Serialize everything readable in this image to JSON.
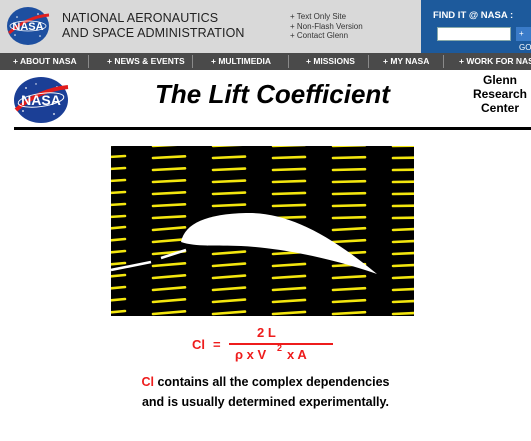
{
  "header": {
    "agency_line1": "NATIONAL AERONAUTICS",
    "agency_line2": "AND SPACE ADMINISTRATION",
    "logo_text": "NASA",
    "utility_links": [
      "+ Text Only Site",
      "+ Non-Flash Version",
      "+ Contact Glenn"
    ],
    "findit_label": "FIND IT @ NASA :",
    "findit_go": "+ GO"
  },
  "nav": {
    "items": [
      "+ ABOUT NASA",
      "+ NEWS & EVENTS",
      "+ MULTIMEDIA",
      "+ MISSIONS",
      "+ MY NASA",
      "+ WORK FOR NASA"
    ]
  },
  "page": {
    "title": "The Lift Coefficient",
    "logo_text": "NASA",
    "center_line1": "Glenn",
    "center_line2": "Research",
    "center_line3": "Center"
  },
  "formula": {
    "lhs": "Cl",
    "equals": "=",
    "numerator": "2 L",
    "denominator_pre": "ρ x V",
    "exponent": "2",
    "denominator_post": "x A"
  },
  "description": {
    "symbol": "Cl",
    "line1_rest": " contains all the complex dependencies",
    "line2": "and is usually determined experimentally."
  },
  "colors": {
    "banner_bg": "#d9d9d9",
    "nav_bg": "#4a4a4a",
    "findit_bg": "#1d5a9c",
    "formula_red": "#ee1c1c",
    "streak_yellow": "#f3e60e"
  }
}
